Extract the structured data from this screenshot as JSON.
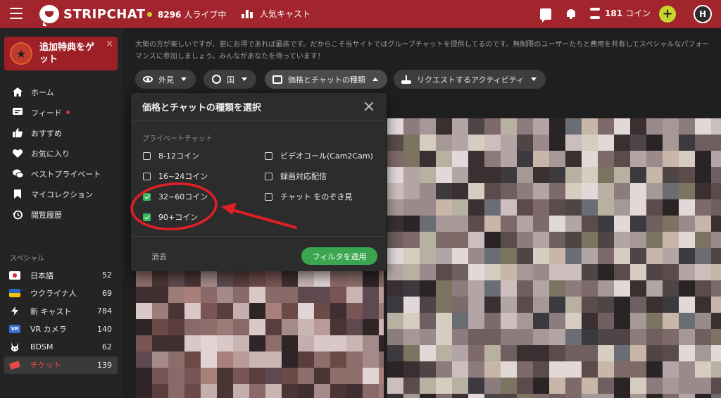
{
  "header": {
    "logo_text": "STRIPCHAT",
    "live_count": "8296",
    "live_label": "人ライブ中",
    "popular_label": "人気キャスト",
    "coin_count": "181",
    "coin_label": "コイン",
    "add_label": "+",
    "avatar_initial": "H"
  },
  "promo": {
    "text": "追加特典をゲット",
    "close": "×"
  },
  "nav": {
    "items": [
      {
        "label": "ホーム",
        "icon": "home-icon"
      },
      {
        "label": "フィード",
        "icon": "feed-icon"
      },
      {
        "label": "おすすめ",
        "icon": "thumbs-up-icon"
      },
      {
        "label": "お気に入り",
        "icon": "heart-icon"
      },
      {
        "label": "ベストプライベート",
        "icon": "chat-bubbles-icon"
      },
      {
        "label": "マイコレクション",
        "icon": "bookmark-icon"
      },
      {
        "label": "閲覧履歴",
        "icon": "history-icon"
      }
    ]
  },
  "special": {
    "title": "スペシャル",
    "items": [
      {
        "label": "日本語",
        "count": "52",
        "icon": "japan-flag-icon"
      },
      {
        "label": "ウクライナ人",
        "count": "69",
        "icon": "ukraine-flag-icon"
      },
      {
        "label": "新 キャスト",
        "count": "784",
        "icon": "lightning-icon"
      },
      {
        "label": "VR カメラ",
        "count": "140",
        "icon": "vr-icon",
        "badge": "VR"
      },
      {
        "label": "BDSM",
        "count": "62",
        "icon": "bunny-icon"
      },
      {
        "label": "チケット",
        "count": "139",
        "icon": "ticket-icon",
        "active": true
      }
    ]
  },
  "main": {
    "intro": "大勢の方が楽しいですが、更にお得であれば最高です。だからこそ当サイトではグループチャットを提供してるのです。無制限のユーザーたちと費用を共有してスペシャルなパフォーマンスに参加しましょう。みんながあなたを待っています！",
    "filters": [
      {
        "label": "外見",
        "icon": "eye-icon"
      },
      {
        "label": "国",
        "icon": "globe-icon"
      },
      {
        "label": "価格とチャットの種類",
        "icon": "price-tag-icon",
        "open": true
      },
      {
        "label": "リクエストするアクティビティ",
        "icon": "joystick-icon"
      }
    ]
  },
  "panel": {
    "title": "価格とチャットの種類を選択",
    "group_label": "プライベートチャット",
    "left_options": [
      {
        "label": "8-12コイン",
        "checked": false
      },
      {
        "label": "16~24コイン",
        "checked": false
      },
      {
        "label": "32~60コイン",
        "checked": true
      },
      {
        "label": "90+コイン",
        "checked": true
      }
    ],
    "right_options": [
      {
        "label": "ビデオコール(Cam2Cam)",
        "checked": false
      },
      {
        "label": "録画対応配信",
        "checked": false
      },
      {
        "label": "チャット をのぞき見",
        "checked": false
      }
    ],
    "clear_label": "消去",
    "apply_label": "フィルタを適用"
  },
  "colors": {
    "brand": "#a2252d",
    "accent_green": "#3aa64f",
    "annotation_red": "#e01f26"
  }
}
